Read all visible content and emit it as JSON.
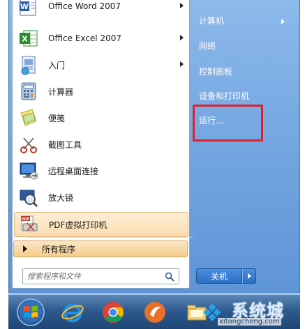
{
  "programs": [
    {
      "label": "Office Word 2007",
      "icon": "word-icon",
      "submenu": true
    },
    {
      "label": "Office Excel 2007",
      "icon": "excel-icon",
      "submenu": true
    },
    {
      "label": "入门",
      "icon": "getting-started-icon",
      "submenu": true
    },
    {
      "label": "计算器",
      "icon": "calculator-icon",
      "submenu": false
    },
    {
      "label": "便笺",
      "icon": "sticky-notes-icon",
      "submenu": false
    },
    {
      "label": "截图工具",
      "icon": "snipping-tool-icon",
      "submenu": false
    },
    {
      "label": "远程桌面连接",
      "icon": "remote-desktop-icon",
      "submenu": false
    },
    {
      "label": "放大镜",
      "icon": "magnifier-icon",
      "submenu": false
    },
    {
      "label": "PDF虚拟打印机",
      "icon": "pdf-printer-icon",
      "submenu": false,
      "highlighted": true
    }
  ],
  "all_programs_label": "所有程序",
  "search": {
    "placeholder": "搜索程序和文件",
    "value": ""
  },
  "right_pane": [
    {
      "label": "计算机",
      "submenu": true
    },
    {
      "label": "网络"
    },
    {
      "label": "控制面板"
    },
    {
      "label": "设备和打印机"
    },
    {
      "label": "运行..."
    }
  ],
  "highlight_color": "#e0202a",
  "shutdown_label": "关机",
  "taskbar": [
    "start-orb-icon",
    "internet-explorer-icon",
    "chrome-icon",
    "app-icon",
    "folder-icon"
  ],
  "watermark": {
    "text": "系统城",
    "url": "xitongcheng.com"
  }
}
